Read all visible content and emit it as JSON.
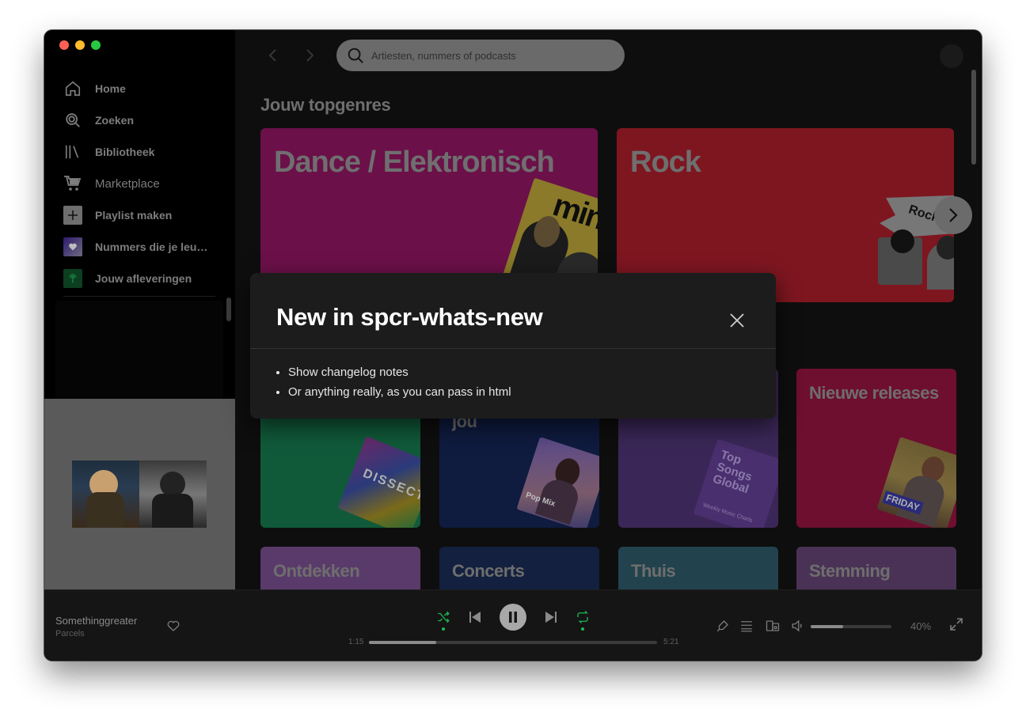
{
  "colors": {
    "traffic_red": "#ff5f57",
    "traffic_yellow": "#febc2e",
    "traffic_green": "#28c840",
    "spotify_green": "#1db954",
    "dance_card": "#6b1049",
    "rock_card": "#7e1620"
  },
  "sidebar": {
    "items": [
      {
        "label": "Home",
        "icon": "home-icon"
      },
      {
        "label": "Zoeken",
        "icon": "search-icon"
      },
      {
        "label": "Bibliotheek",
        "icon": "library-icon"
      },
      {
        "label": "Marketplace",
        "icon": "cart-icon"
      },
      {
        "label": "Playlist maken",
        "icon": "plus-icon"
      },
      {
        "label": "Nummers die je leuk vindt",
        "icon": "liked-songs-icon"
      },
      {
        "label": "Jouw afleveringen",
        "icon": "episodes-icon"
      }
    ]
  },
  "search": {
    "placeholder": "Artiesten, nummers of podcasts"
  },
  "main": {
    "section_title": "Jouw topgenres",
    "genres": [
      {
        "title": "Dance / Elektronisch"
      },
      {
        "title": "Rock"
      }
    ],
    "browse": [
      {
        "title": ""
      },
      {
        "title": "jou"
      },
      {
        "title": ""
      },
      {
        "title": "Nieuwe releases"
      }
    ],
    "browse_bottom": [
      {
        "title": "Ontdekken"
      },
      {
        "title": "Concerts"
      },
      {
        "title": "Thuis"
      },
      {
        "title": "Stemming"
      }
    ],
    "art_text": {
      "mint": "mint",
      "rock": "Rock",
      "dissect": "DISSECT",
      "pop_mix": "Pop Mix",
      "top_songs": "Top Songs Global",
      "weekly": "Weekly Music Charts",
      "friday": "FRIDAY"
    }
  },
  "modal": {
    "title": "New in spcr-whats-new",
    "notes": [
      "Show changelog notes",
      "Or anything really, as you can pass in html"
    ]
  },
  "player": {
    "track_title": "Somethinggreater",
    "track_artist": "Parcels",
    "elapsed": "1:15",
    "duration": "5:21",
    "progress": 0.234,
    "volume": 0.4,
    "volume_label": "40%"
  }
}
